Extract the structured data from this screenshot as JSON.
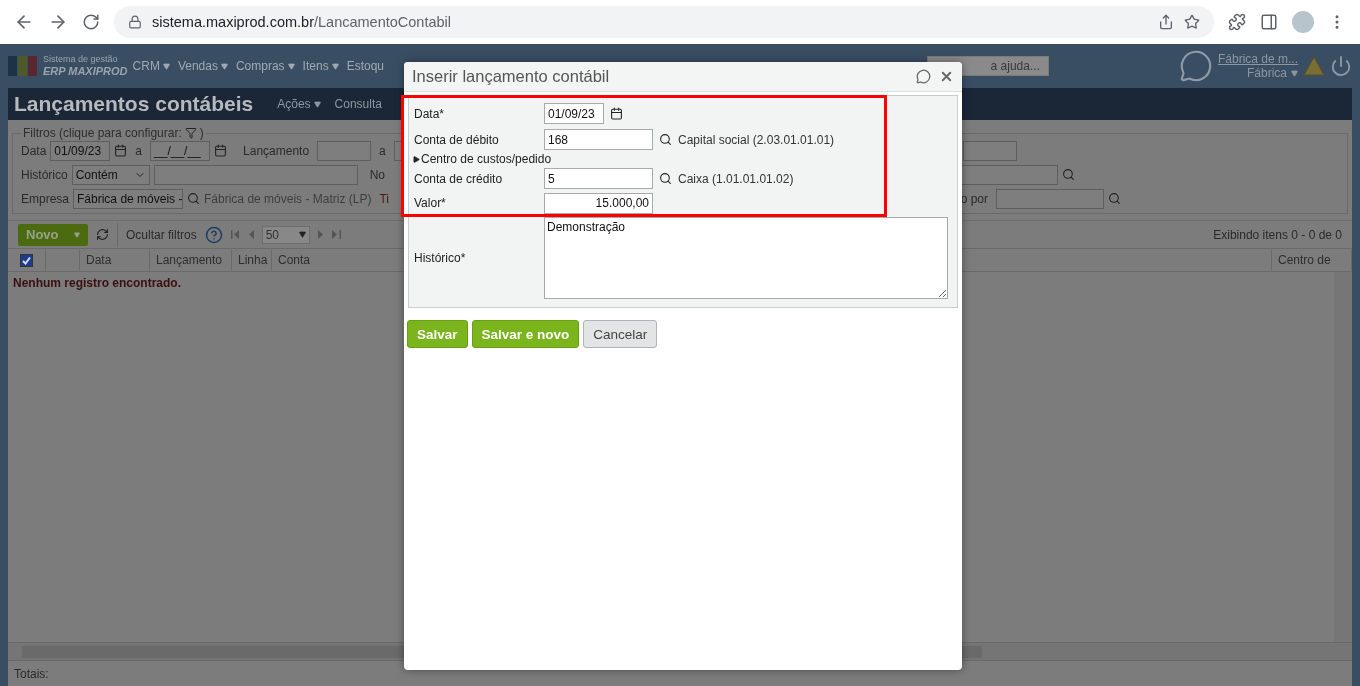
{
  "browser": {
    "url_host": "sistema.maxiprod.com.br",
    "url_path": "/LancamentoContabil"
  },
  "header": {
    "logo_lines": [
      "Sistema de gestão",
      "ERP MAXIPROD"
    ],
    "menu": [
      "CRM",
      "Vendas",
      "Compras",
      "Itens",
      "Estoqu"
    ],
    "search_placeholder": "a ajuda...",
    "company": "Fábrica de m...",
    "branch": "Fábrica"
  },
  "page": {
    "title": "Lançamentos contábeis",
    "actions": [
      "Ações",
      "Consulta"
    ]
  },
  "filters": {
    "legend": "Filtros (clique para configurar:",
    "legend_end": ")",
    "data": {
      "label": "Data",
      "from": "01/09/23",
      "sep": "a",
      "to": "__/__/__"
    },
    "lancamento": {
      "label": "Lançamento",
      "sep": "a"
    },
    "historico": {
      "label": "Histórico",
      "mode": "Contém"
    },
    "nota_label": "No",
    "empresa": {
      "label": "Empresa",
      "value": "Fábrica de móveis -",
      "name": "Fábrica de móveis - Matriz (LP)"
    },
    "tipo_label": "Ti",
    "por_label": "o por"
  },
  "toolbar": {
    "new": "Novo",
    "hide_filters": "Ocultar filtros",
    "page_size": "50",
    "count": "Exibindo itens 0 - 0 de 0"
  },
  "table": {
    "select_all": true,
    "columns": [
      "Data",
      "Lançamento",
      "Linha",
      "Conta"
    ],
    "last_column": "Centro de",
    "empty": "Nenhum registro encontrado.",
    "totals": "Totais:"
  },
  "dialog": {
    "title": "Inserir lançamento contábil",
    "fields": [
      {
        "kind": "date",
        "label": "Data*",
        "value": "01/09/23"
      },
      {
        "kind": "lookup",
        "label": "Conta de débito",
        "value": "168",
        "description": "Capital social (2.03.01.01.01)"
      },
      {
        "kind": "toggle",
        "label": "Centro de custos/pedido",
        "expanded": false
      },
      {
        "kind": "lookup",
        "label": "Conta de crédito",
        "value": "5",
        "description": "Caixa (1.01.01.01.02)"
      },
      {
        "kind": "amount",
        "label": "Valor*",
        "value": "15.000,00"
      }
    ],
    "history": {
      "label": "Histórico*",
      "value": "Demonstração"
    },
    "buttons": [
      {
        "label": "Salvar",
        "kind": "primary"
      },
      {
        "label": "Salvar e novo",
        "kind": "primary"
      },
      {
        "label": "Cancelar",
        "kind": "secondary"
      }
    ]
  }
}
